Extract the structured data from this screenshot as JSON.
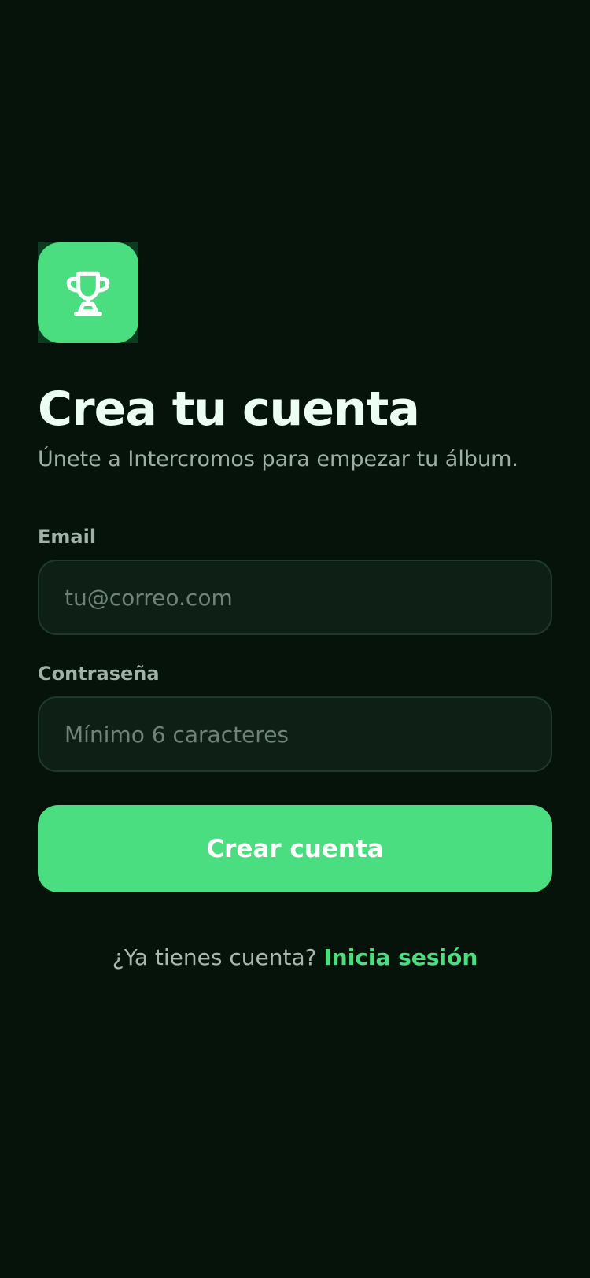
{
  "app": {
    "background_color": "#06130b",
    "accent_color": "#4ade80"
  },
  "logo": {
    "icon": "trophy-icon"
  },
  "header": {
    "title": "Crea tu cuenta",
    "subtitle": "Únete a Intercromos para empezar tu álbum."
  },
  "form": {
    "email_label": "Email",
    "email_placeholder": "tu@correo.com",
    "email_value": "",
    "password_label": "Contraseña",
    "password_placeholder": "Mínimo 6 caracteres",
    "password_value": "",
    "submit_label": "Crear cuenta"
  },
  "footer": {
    "prompt": "¿Ya tienes cuenta?",
    "link_label": "Inicia sesión"
  }
}
